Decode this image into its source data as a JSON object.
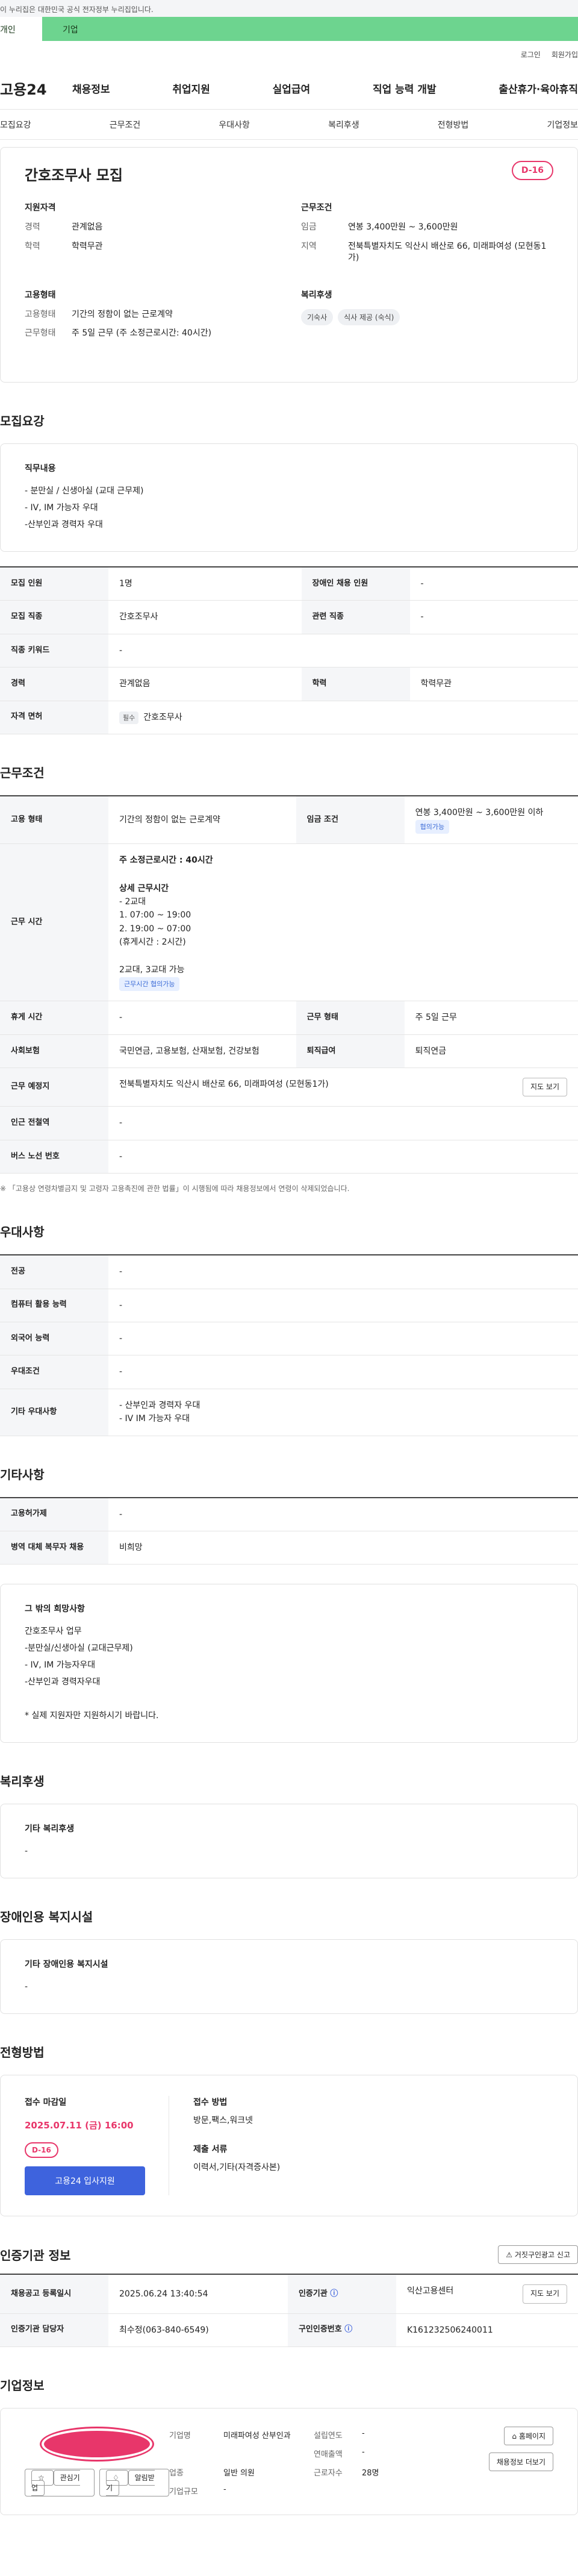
{
  "gov_banner": "이 누리집은 대한민국 공식 전자정부 누리집입니다.",
  "top_tabs": [
    "개인",
    "기업"
  ],
  "util_links": [
    "로그인",
    "회원가입"
  ],
  "logo": "고용24",
  "gnb": [
    "채용정보",
    "취업지원",
    "실업급여",
    "직업 능력 개발",
    "출산휴가·육아휴직"
  ],
  "subtabs": [
    "모집요강",
    "근무조건",
    "우대사항",
    "복리후생",
    "전형방법",
    "기업정보"
  ],
  "title_card": {
    "title": "간호조무사 모집",
    "dday": "D-16",
    "support": {
      "head": "지원자격",
      "rows": [
        {
          "k": "경력",
          "v": "관계없음"
        },
        {
          "k": "학력",
          "v": "학력무관"
        }
      ]
    },
    "work": {
      "head": "근무조건",
      "rows": [
        {
          "k": "임금",
          "v": "연봉 3,400만원 ~ 3,600만원"
        },
        {
          "k": "지역",
          "v": "전북특별자치도 익산시 배산로 66, 미래파여성 (모현동1가)"
        }
      ]
    },
    "employ": {
      "head": "고용형태",
      "rows": [
        {
          "k": "고용형태",
          "v": "기간의 정함이 없는 근로계약"
        },
        {
          "k": "근무형태",
          "v": "주 5일 근무 (주 소정근로시간: 40시간)"
        }
      ]
    },
    "welfare": {
      "head": "복리후생",
      "pills": [
        "기숙사",
        "식사 제공 (숙식)"
      ]
    }
  },
  "recruit": {
    "title": "모집요강",
    "duty_head": "직무내용",
    "duties": [
      "- 분만실 / 신생아실 (교대 근무제)",
      "- IV, IM 가능자 우대",
      "-산부인과 경력자 우대"
    ],
    "rows": [
      {
        "k1": "모집 인원",
        "v1": "1명",
        "k2": "장애인 채용 인원",
        "v2": "-"
      },
      {
        "k1": "모집 직종",
        "v1": "간호조무사",
        "k2": "관련 직종",
        "v2": "-"
      },
      {
        "k1": "직종 키워드",
        "v1": "-"
      },
      {
        "k1": "경력",
        "v1": "관계없음",
        "k2": "학력",
        "v2": "학력무관"
      },
      {
        "k1": "자격 면허",
        "tag": "필수",
        "v1": "간호조무사"
      }
    ]
  },
  "work_cond": {
    "title": "근무조건",
    "employ_type_k": "고용 형태",
    "employ_type_v": "기간의 정함이 없는 근로계약",
    "wage_k": "임금 조건",
    "wage_v": "연봉 3,400만원 ~ 3,600만원 이하",
    "wage_tag": "협의가능",
    "hours_k": "근무 시간",
    "hours_main": "주 소정근로시간 : 40시간",
    "hours_detail_head": "상세 근무시간",
    "hours_detail": [
      "- 2교대",
      "1. 07:00 ~ 19:00",
      "2. 19:00 ~ 07:00",
      "(휴게시간 : 2시간)",
      "",
      "2교대, 3교대 가능"
    ],
    "hours_tag": "근무시간 협의가능",
    "break_k": "휴게 시간",
    "break_v": "-",
    "form_k": "근무 형태",
    "form_v": "주 5일 근무",
    "ins_k": "사회보험",
    "ins_v": "국민연금, 고용보험, 산재보험, 건강보험",
    "retire_k": "퇴직급여",
    "retire_v": "퇴직연금",
    "place_k": "근무 예정지",
    "place_v": "전북특별자치도 익산시 배산로 66, 미래파여성 (모현동1가)",
    "map_btn": "지도 보기",
    "subway_k": "인근 전철역",
    "subway_v": "-",
    "bus_k": "버스 노선 번호",
    "bus_v": "-",
    "note": "※ 「고용상 연령차별금지 및 고령자 고용촉진에 관한 법률」이 시행됨에 따라 채용정보에서 연령이 삭제되었습니다."
  },
  "prefer": {
    "title": "우대사항",
    "rows": [
      {
        "k": "전공",
        "v": "-"
      },
      {
        "k": "컴퓨터 활용 능력",
        "v": "-"
      },
      {
        "k": "외국어 능력",
        "v": "-"
      },
      {
        "k": "우대조건",
        "v": "-"
      },
      {
        "k": "기타 우대사항",
        "v": "- 산부인과 경력자 우대\n- IV IM 가능자 우대"
      }
    ]
  },
  "etc": {
    "title": "기타사항",
    "rows": [
      {
        "k": "고용허가제",
        "v": "-"
      },
      {
        "k": "병역 대체 복무자 채용",
        "v": "비희망"
      }
    ],
    "box_head": "그 밖의 희망사항",
    "box_lines": [
      "간호조무사 업무",
      "-분만실/신생아실 (교대근무제)",
      "- IV, IM 가능자우대",
      "-산부인과 경력자우대",
      "",
      "* 실제 지원자만 지원하시기 바랍니다."
    ]
  },
  "welfare": {
    "title": "복리후생",
    "head": "기타 복리후생",
    "v": "-"
  },
  "disabled": {
    "title": "장애인용 복지시설",
    "head": "기타 장애인용 복지시설",
    "v": "-"
  },
  "process": {
    "title": "전형방법",
    "deadline_head": "접수 마감일",
    "deadline": "2025.07.11 (금) 16:00",
    "dday": "D-16",
    "apply_btn": "고용24 입사지원",
    "method_head": "접수 방법",
    "method": "방문,팩스,워크넷",
    "docs_head": "제출 서류",
    "docs": "이력서,기타(자격증사본)"
  },
  "agency": {
    "title": "인증기관 정보",
    "report_btn": "거짓구인광고 신고",
    "rows": [
      {
        "k1": "채용공고 등록일시",
        "v1": "2025.06.24 13:40:54",
        "k2": "인증기관",
        "v2": "익산고용센터",
        "btn": "지도 보기"
      },
      {
        "k1": "인증기관 담당자",
        "v1": "최수정(063-840-6549)",
        "k2": "구인인증번호",
        "v2": "K161232506240011"
      }
    ]
  },
  "company": {
    "title": "기업정보",
    "logo_btns": [
      "관심기업",
      "알림받기"
    ],
    "info": [
      {
        "k": "기업명",
        "v": "미래파여성 산부인과",
        "k2": "설립연도",
        "v2": "-"
      },
      {
        "k": "",
        "v": "",
        "k2": "연매출액",
        "v2": "-"
      },
      {
        "k": "업종",
        "v": "일반 의원",
        "k2": "근로자수",
        "v2": "28명"
      },
      {
        "k": "기업규모",
        "v": "-",
        "k2": "",
        "v2": ""
      }
    ],
    "btns": [
      "홈페이지",
      "채용정보 더보기"
    ]
  },
  "colors": {
    "accent": "#e8366a",
    "primary": "#3e63dd",
    "green": "#6dd48f"
  }
}
